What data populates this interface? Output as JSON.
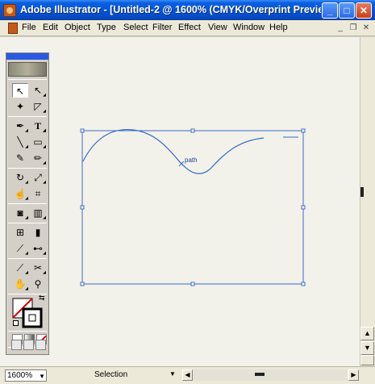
{
  "window": {
    "title": "Adobe Illustrator - [Untitled-2 @ 1600% (CMYK/Overprint Previe",
    "buttons": {
      "minimize": "_",
      "maximize": "□",
      "close": "✕"
    }
  },
  "menubar": {
    "items": [
      "File",
      "Edit",
      "Object",
      "Type",
      "Select",
      "Filter",
      "Effect",
      "View",
      "Window",
      "Help"
    ],
    "mdi": {
      "minimize": "_",
      "restore": "❐",
      "close": "✕"
    }
  },
  "canvas": {
    "path_label": "path",
    "accent_color": "#2a5ae0",
    "path_color": "#3a6ac8"
  },
  "toolbox": {
    "tools": [
      {
        "name": "selection-tool",
        "glyph": "↖",
        "active": true
      },
      {
        "name": "direct-selection-tool",
        "glyph": "↖"
      },
      {
        "name": "magic-wand-tool",
        "glyph": "✦"
      },
      {
        "name": "lasso-tool",
        "glyph": "◸"
      },
      {
        "name": "pen-tool",
        "glyph": "✒"
      },
      {
        "name": "type-tool",
        "glyph": "T"
      },
      {
        "name": "line-tool",
        "glyph": "╲"
      },
      {
        "name": "rectangle-tool",
        "glyph": "▭"
      },
      {
        "name": "paintbrush-tool",
        "glyph": "✎"
      },
      {
        "name": "pencil-tool",
        "glyph": "✏"
      },
      {
        "name": "rotate-tool",
        "glyph": "↻"
      },
      {
        "name": "scale-tool",
        "glyph": "⤢"
      },
      {
        "name": "warp-tool",
        "glyph": "☝"
      },
      {
        "name": "free-transform-tool",
        "glyph": "⌗"
      },
      {
        "name": "symbol-sprayer-tool",
        "glyph": "◙"
      },
      {
        "name": "graph-tool",
        "glyph": "▥"
      },
      {
        "name": "mesh-tool",
        "glyph": "⊞"
      },
      {
        "name": "gradient-tool",
        "glyph": "▮"
      },
      {
        "name": "eyedropper-tool",
        "glyph": "⟋"
      },
      {
        "name": "blend-tool",
        "glyph": "⊷"
      },
      {
        "name": "slice-tool",
        "glyph": "⟋"
      },
      {
        "name": "scissors-tool",
        "glyph": "✂"
      },
      {
        "name": "hand-tool",
        "glyph": "✋"
      },
      {
        "name": "zoom-tool",
        "glyph": "⚲"
      }
    ]
  },
  "statusbar": {
    "zoom": "1600%",
    "status": "Selection"
  }
}
